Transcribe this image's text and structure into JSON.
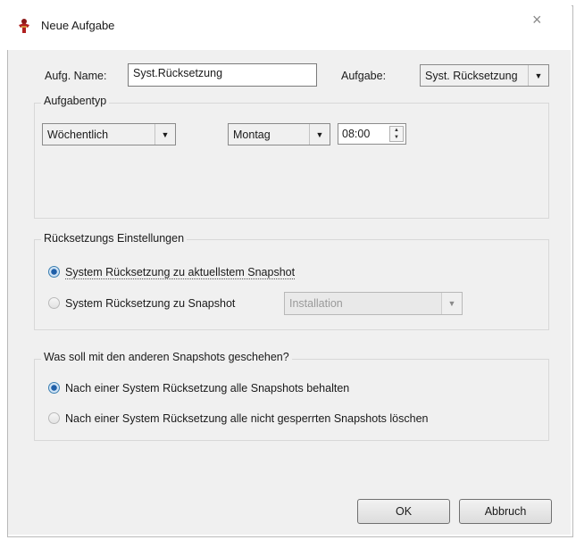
{
  "window": {
    "title": "Neue Aufgabe",
    "close_glyph": "×",
    "icon": "app-figure-icon"
  },
  "task": {
    "name_label": "Aufg. Name:",
    "name_value": "Syst.Rücksetzung",
    "task_label": "Aufgabe:",
    "task_value": "Syst. Rücksetzung"
  },
  "tasktype": {
    "group_title": "Aufgabentyp",
    "frequency": "Wöchentlich",
    "day": "Montag",
    "time": "08:00"
  },
  "reset": {
    "group_title": "Rücksetzungs Einstellungen",
    "option1": "System Rücksetzung zu aktuellstem Snapshot",
    "option2": "System Rücksetzung zu Snapshot",
    "snapshot_value": "Installation",
    "selected": 1
  },
  "others": {
    "group_title": "Was soll mit den anderen Snapshots geschehen?",
    "option1": "Nach einer System Rücksetzung alle Snapshots behalten",
    "option2": "Nach einer System Rücksetzung alle nicht gesperrten Snapshots löschen",
    "selected": 1
  },
  "buttons": {
    "ok": "OK",
    "cancel": "Abbruch"
  },
  "colors": {
    "accent": "#3c7fb1",
    "client_bg": "#f0f0f0"
  }
}
